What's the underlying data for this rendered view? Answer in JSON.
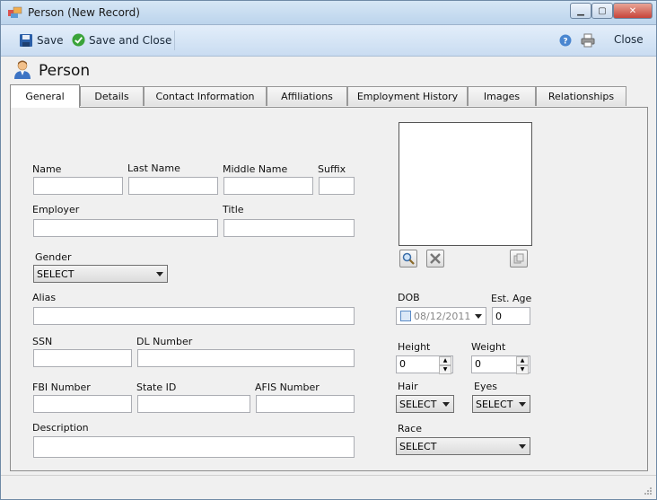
{
  "window": {
    "title": "Person (New Record)"
  },
  "toolbar": {
    "save_label": "Save",
    "save_close_label": "Save and Close",
    "close_label": "Close"
  },
  "header": {
    "title": "Person"
  },
  "tabs": [
    {
      "label": "General",
      "active": true
    },
    {
      "label": "Details"
    },
    {
      "label": "Contact Information"
    },
    {
      "label": "Affiliations"
    },
    {
      "label": "Employment History"
    },
    {
      "label": "Images"
    },
    {
      "label": "Relationships"
    }
  ],
  "form": {
    "name": {
      "label": "Name",
      "value": ""
    },
    "last_name": {
      "label": "Last Name",
      "value": ""
    },
    "middle_name": {
      "label": "Middle Name",
      "value": ""
    },
    "suffix": {
      "label": "Suffix",
      "value": ""
    },
    "employer": {
      "label": "Employer",
      "value": ""
    },
    "title": {
      "label": "Title",
      "value": ""
    },
    "gender": {
      "label": "Gender",
      "value": "SELECT"
    },
    "alias": {
      "label": "Alias",
      "value": ""
    },
    "ssn": {
      "label": "SSN",
      "value": ""
    },
    "dl_number": {
      "label": "DL Number",
      "value": ""
    },
    "fbi_number": {
      "label": "FBI Number",
      "value": ""
    },
    "state_id": {
      "label": "State ID",
      "value": ""
    },
    "afis_number": {
      "label": "AFIS Number",
      "value": ""
    },
    "description": {
      "label": "Description",
      "value": ""
    },
    "dob": {
      "label": "DOB",
      "value": "08/12/2011"
    },
    "est_age": {
      "label": "Est. Age",
      "value": "0"
    },
    "height": {
      "label": "Height",
      "value": "0"
    },
    "weight": {
      "label": "Weight",
      "value": "0"
    },
    "hair": {
      "label": "Hair",
      "value": "SELECT"
    },
    "eyes": {
      "label": "Eyes",
      "value": "SELECT"
    },
    "race": {
      "label": "Race",
      "value": "SELECT"
    }
  },
  "colors": {
    "title_bar": "#c9dcf1",
    "toolbar": "#d6e6f7",
    "panel": "#f0f0f0",
    "accent_green": "#3aa33a",
    "accent_blue": "#2b5fa8"
  }
}
